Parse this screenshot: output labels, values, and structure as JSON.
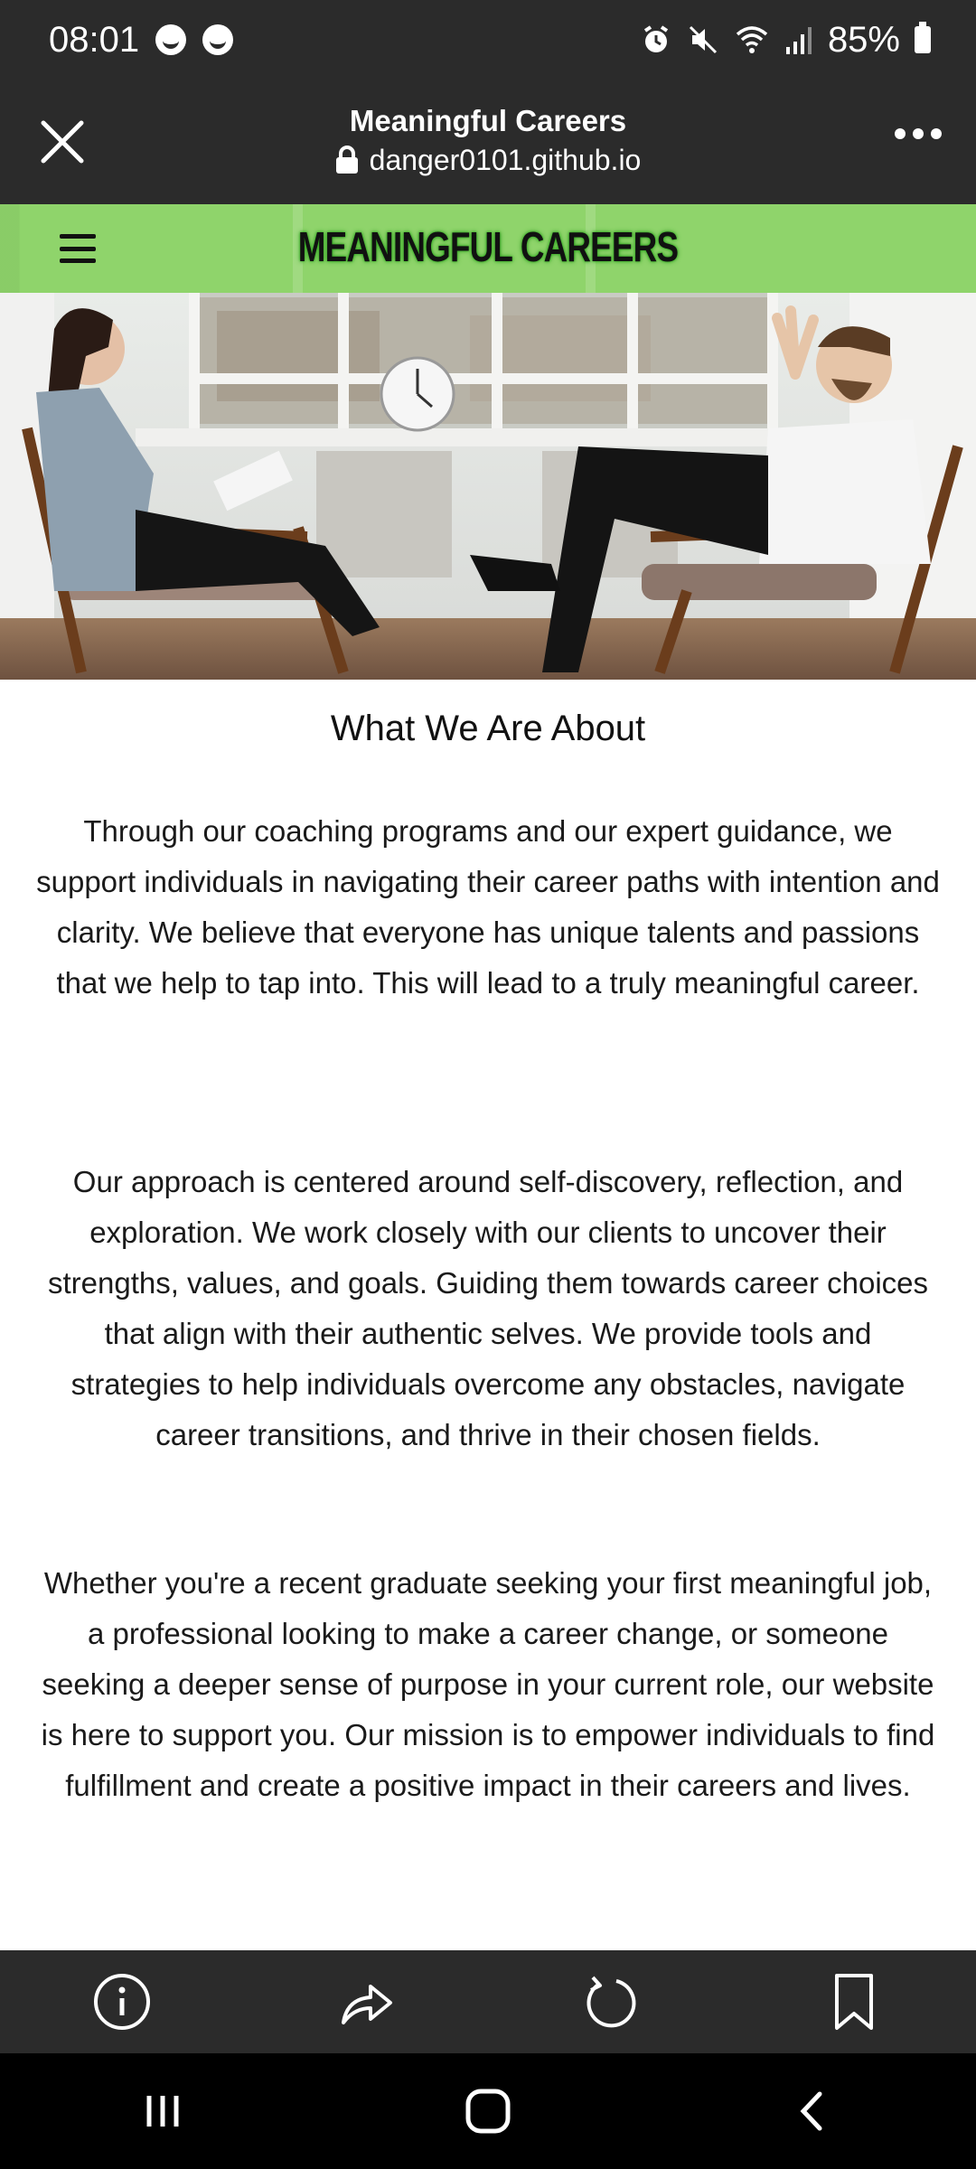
{
  "status_bar": {
    "time": "08:01",
    "battery": "85%",
    "icons": [
      "smiley-icon",
      "smiley-icon",
      "alarm-icon",
      "mute-icon",
      "wifi-icon",
      "signal-icon",
      "battery-icon"
    ]
  },
  "browser": {
    "page_title": "Meaningful Careers",
    "url": "danger0101.github.io",
    "close_icon": "close-icon",
    "menu_icon": "more-icon"
  },
  "site": {
    "brand": "MEANINGFUL CAREERS",
    "nav_icon": "hamburger-menu-icon"
  },
  "content": {
    "heading": "What We Are About",
    "paragraphs": [
      "Through our coaching programs and our expert guidance, we support individuals in navigating their career paths with intention and clarity. We believe that everyone has unique talents and passions that we help to tap into. This will lead to a truly meaningful career.",
      "Our approach is centered around self-discovery, reflection, and exploration. We work closely with our clients to uncover their strengths, values, and goals. Guiding them towards career choices that align with their authentic selves. We provide tools and strategies to help individuals overcome any obstacles, navigate career transitions, and thrive in their chosen fields.",
      "Whether you're a recent graduate seeking your first meaningful job, a professional looking to make a career change, or someone seeking a deeper sense of purpose in your current role, our website is here to support you. Our mission is to empower individuals to find fulfillment and create a positive impact in their careers and lives."
    ]
  },
  "toolbar": {
    "icons": [
      "info-icon",
      "share-icon",
      "refresh-icon",
      "bookmark-icon"
    ]
  },
  "system_nav": {
    "icons": [
      "recent-apps-icon",
      "home-icon",
      "back-icon"
    ]
  },
  "colors": {
    "bar_dark": "#2b2b2b",
    "nav_green": "#8fd46b",
    "brand_glow": "#2ea21f"
  }
}
